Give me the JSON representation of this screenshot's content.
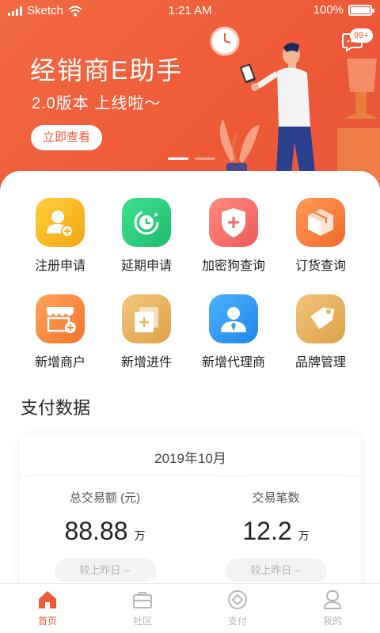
{
  "status_bar": {
    "carrier": "Sketch",
    "time": "1:21 AM",
    "battery": "100%"
  },
  "banner": {
    "title": "经销商E助手",
    "subtitle": "2.0版本 上线啦～",
    "button_label": "立即查看",
    "message_badge": "99+",
    "slide_count": 2,
    "active_slide": 1
  },
  "shortcuts": [
    {
      "label": "注册申请",
      "icon": "register-user-icon",
      "color": "#f7b51d"
    },
    {
      "label": "延期申请",
      "icon": "clock-renew-icon",
      "color": "#2dcc7f"
    },
    {
      "label": "加密狗查询",
      "icon": "shield-plus-icon",
      "color": "#f26a65"
    },
    {
      "label": "订货查询",
      "icon": "box-icon",
      "color": "#f4783a"
    },
    {
      "label": "新增商户",
      "icon": "store-plus-icon",
      "color": "#f5843a"
    },
    {
      "label": "新增进件",
      "icon": "document-plus-icon",
      "color": "#e8b460"
    },
    {
      "label": "新增代理商",
      "icon": "agent-icon",
      "color": "#2f9bf0"
    },
    {
      "label": "品牌管理",
      "icon": "tag-icon",
      "color": "#e8b460"
    }
  ],
  "payment": {
    "section_title": "支付数据",
    "date": "2019年10月",
    "stats": [
      {
        "label": "总交易额 (元)",
        "value": "88.88",
        "unit": "万",
        "compare": "较上昨日 --"
      },
      {
        "label": "交易笔数",
        "value": "12.2",
        "unit": "万",
        "compare": "较上昨日 --"
      }
    ]
  },
  "tabs": [
    {
      "label": "首页",
      "icon": "home-icon",
      "active": true
    },
    {
      "label": "社区",
      "icon": "briefcase-icon",
      "active": false
    },
    {
      "label": "支付",
      "icon": "payment-icon",
      "active": false
    },
    {
      "label": "我的",
      "icon": "profile-icon",
      "active": false
    }
  ],
  "colors": {
    "brand": "#ef5a38",
    "tab_inactive": "#b5b5b5",
    "text": "#222222"
  }
}
